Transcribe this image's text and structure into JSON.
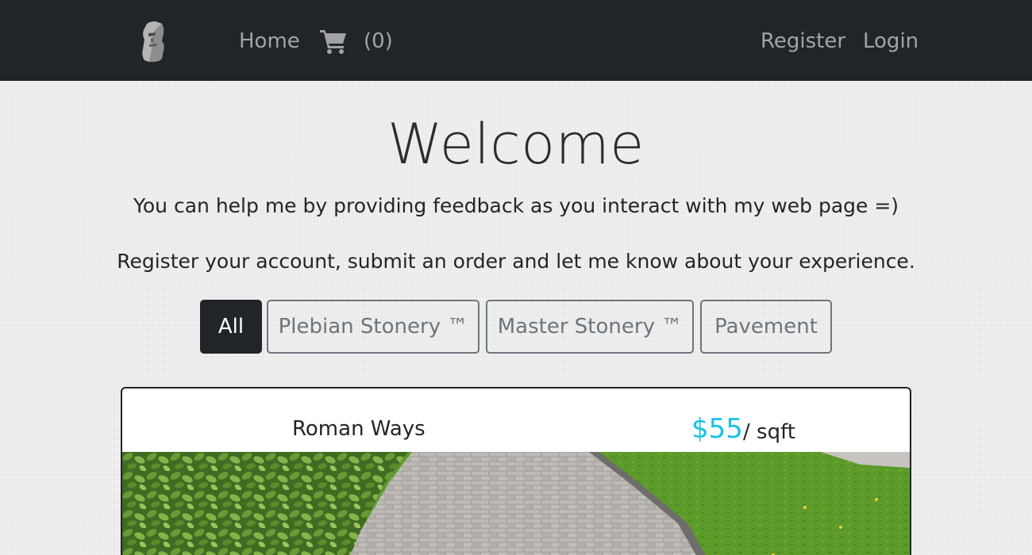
{
  "navbar": {
    "logo_icon": "moai-statue-icon",
    "home_label": "Home",
    "cart_icon": "shopping-cart-icon",
    "cart_count": "(0)",
    "register_label": "Register",
    "login_label": "Login"
  },
  "hero": {
    "title": "Welcome",
    "line1": "You can help me by providing feedback as you interact with my web page =)",
    "line2": "Register your account, submit an order and let me know about your experience."
  },
  "filters": {
    "selected": "All",
    "options": [
      "All",
      "Plebian Stonery ™",
      "Master Stonery ™",
      "Pavement"
    ]
  },
  "product": {
    "name": "Roman Ways",
    "price": "$55",
    "unit": "/ sqft",
    "image_icon": "stone-path-photo"
  },
  "colors": {
    "navbar_bg": "#212529",
    "price_accent": "#17c1e8",
    "active_filter_bg": "#212529",
    "filter_border": "#6c757d"
  }
}
